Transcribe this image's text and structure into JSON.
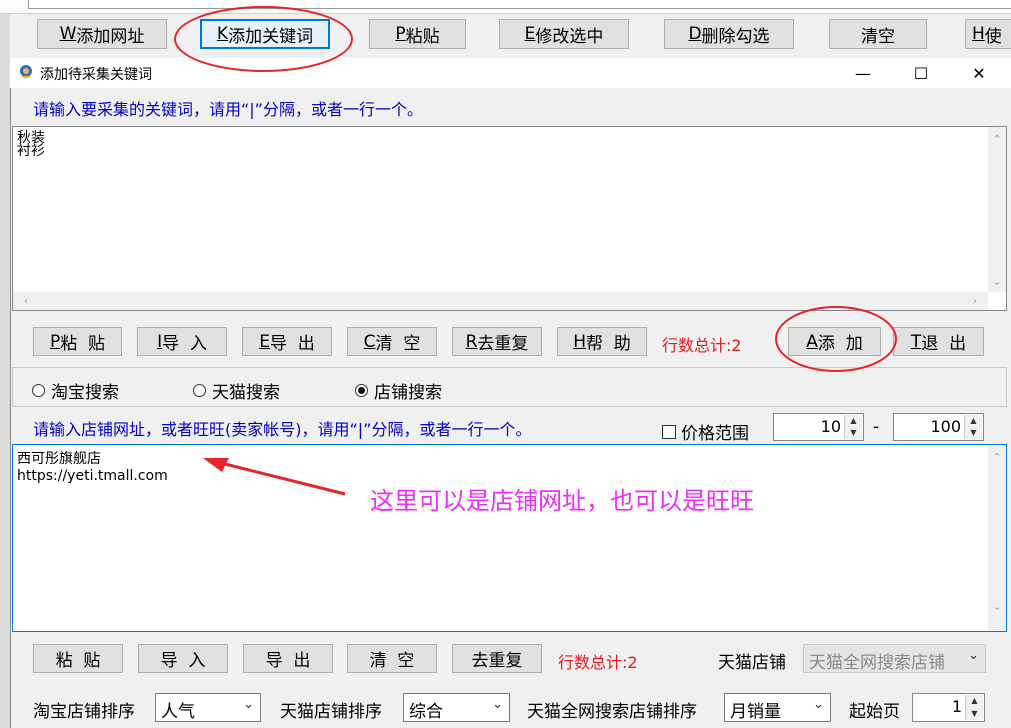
{
  "toolbar": {
    "buttons": [
      {
        "key": "W",
        "label": "添加网址"
      },
      {
        "key": "K",
        "label": "添加关键词"
      },
      {
        "key": "P",
        "label": "粘贴"
      },
      {
        "key": "E",
        "label": "修改选中"
      },
      {
        "key": "D",
        "label": "删除勾选"
      },
      {
        "key": "",
        "label": "清空"
      },
      {
        "key": "H",
        "label": "使"
      }
    ]
  },
  "dialog": {
    "title": "添加待采集关键词",
    "controls": {
      "minimize": "—",
      "maximize": "☐",
      "close": "✕"
    },
    "keyword_hint": "请输入要采集的关键词，请用“|”分隔，或者一行一个。",
    "keywords_text": "秋装\n衬衫",
    "kw_buttons": [
      {
        "key": "P",
        "label": "粘  贴"
      },
      {
        "key": "I",
        "label": "导  入"
      },
      {
        "key": "E",
        "label": "导  出"
      },
      {
        "key": "C",
        "label": "清  空"
      },
      {
        "key": "R",
        "label": "去重复"
      },
      {
        "key": "H",
        "label": "帮  助"
      }
    ],
    "kw_row_count": "行数总计:2",
    "add_button": {
      "key": "A",
      "label": "添  加"
    },
    "exit_button": {
      "key": "T",
      "label": "退  出"
    },
    "search_modes": [
      {
        "label": "淘宝搜索",
        "selected": false
      },
      {
        "label": "天猫搜索",
        "selected": false
      },
      {
        "label": "店铺搜索",
        "selected": true
      }
    ],
    "shop_hint": "请输入店铺网址，或者旺旺(卖家帐号)，请用“|”分隔，或者一行一个。",
    "price_range": {
      "label": "价格范围",
      "checked": false,
      "min": "10",
      "separator": "-",
      "max": "100"
    },
    "shop_text": "西可彤旗舰店\nhttps://yeti.tmall.com",
    "shop_buttons": [
      {
        "label": "粘  贴"
      },
      {
        "label": "导  入"
      },
      {
        "label": "导  出"
      },
      {
        "label": "清  空"
      },
      {
        "label": "去重复"
      }
    ],
    "shop_row_count": "行数总计:2",
    "tmall_shop": {
      "label": "天猫店铺",
      "value": "天猫全网搜索店铺"
    },
    "sort": {
      "taobao_label": "淘宝店铺排序",
      "taobao_value": "人气",
      "tmall_label": "天猫店铺排序",
      "tmall_value": "综合",
      "tmall_all_label": "天猫全网搜索店铺排序",
      "tmall_all_value": "月销量",
      "start_page_label": "起始页",
      "start_page_value": "1"
    }
  },
  "annotation": {
    "text": "这里可以是店铺网址，也可以是旺旺",
    "color": "#f02bff"
  },
  "colors": {
    "hint": "#0000d0",
    "count": "#e31b1b",
    "accent": "#0078d7",
    "annotation_circle": "#e8222a"
  }
}
